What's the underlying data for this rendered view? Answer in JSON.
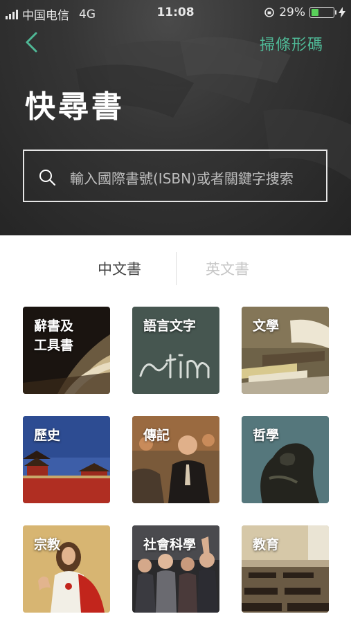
{
  "status_bar": {
    "carrier": "中国电信",
    "network": "4G",
    "time": "11:08",
    "battery": "29%",
    "battery_level": 0.29
  },
  "header": {
    "back_icon": "chevron-left-icon",
    "scan_label": "掃條形碼",
    "title": "快尋書"
  },
  "search": {
    "icon": "search-icon",
    "placeholder": "輸入國際書號(ISBN)或者關鍵字搜索"
  },
  "tabs": [
    {
      "label": "中文書",
      "active": true
    },
    {
      "label": "英文書",
      "active": false
    }
  ],
  "categories": [
    {
      "label": "辭書及\n工具書"
    },
    {
      "label": "語言文字"
    },
    {
      "label": "文學"
    },
    {
      "label": "歷史"
    },
    {
      "label": "傳記"
    },
    {
      "label": "哲學"
    },
    {
      "label": "宗教"
    },
    {
      "label": "社會科學"
    },
    {
      "label": "教育"
    }
  ],
  "colors": {
    "accent": "#4fb896",
    "header_bg": "#2e2e2e",
    "active_tab": "#444444",
    "inactive_tab": "#c6c6c6"
  }
}
